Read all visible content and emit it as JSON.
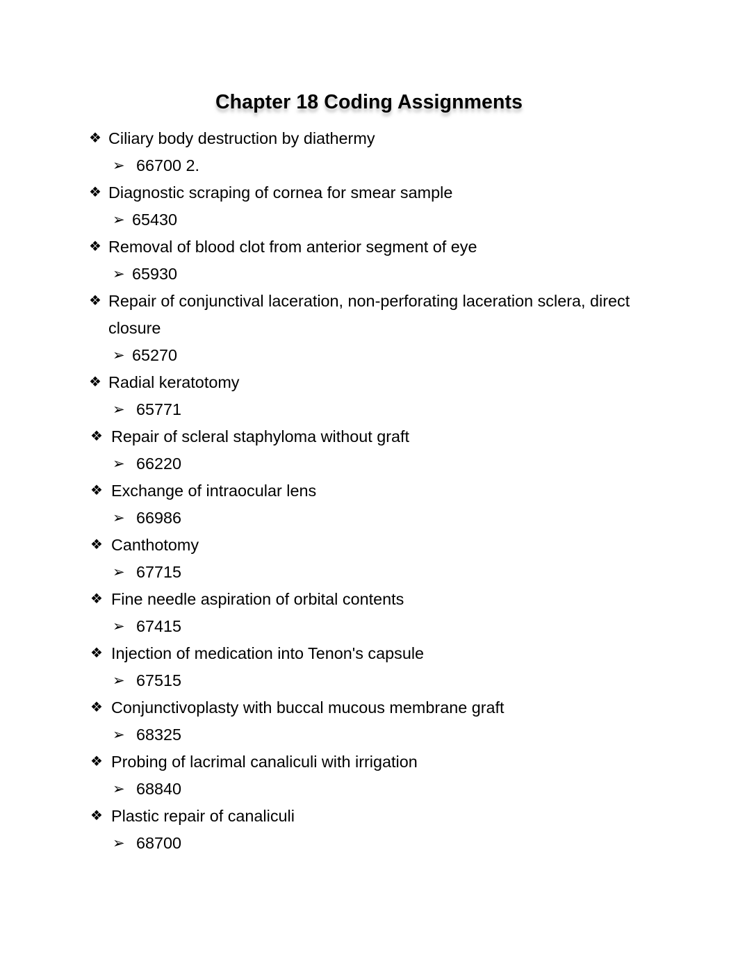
{
  "document": {
    "title": "Chapter 18 Coding Assignments",
    "background_color": "#ffffff",
    "text_color": "#000000",
    "title_shadow_color": "#8c8c8c"
  },
  "bullets": {
    "level1_glyph": "❖",
    "level1_glyph_name": "four-diamond-bullet-icon",
    "level2_glyph": "➢",
    "level2_glyph_name": "arrowhead-bullet-icon"
  },
  "items": [
    {
      "procedure": "Ciliary body destruction by diathermy",
      "code": "66700 2.",
      "indent_group": 1,
      "code_wide": true
    },
    {
      "procedure": "Diagnostic scraping of cornea for smear sample",
      "code": "65430",
      "indent_group": 1,
      "code_wide": false
    },
    {
      "procedure": "Removal of blood clot from anterior segment of eye",
      "code": "65930",
      "indent_group": 1,
      "code_wide": false
    },
    {
      "procedure": "Repair of conjunctival laceration, non-perforating laceration sclera, direct closure",
      "code": "65270",
      "indent_group": 1,
      "code_wide": false
    },
    {
      "procedure": "Radial keratotomy",
      "code": "65771",
      "indent_group": 1,
      "code_wide": true
    },
    {
      "procedure": "Repair of scleral staphyloma without graft",
      "code": "66220",
      "indent_group": 2,
      "code_wide": true
    },
    {
      "procedure": "Exchange of intraocular lens",
      "code": "66986",
      "indent_group": 2,
      "code_wide": true
    },
    {
      "procedure": "Canthotomy",
      "code": "67715",
      "indent_group": 2,
      "code_wide": true
    },
    {
      "procedure": "Fine needle aspiration of orbital contents",
      "code": "67415",
      "indent_group": 2,
      "code_wide": true
    },
    {
      "procedure": "Injection of medication into Tenon's capsule",
      "code": "67515",
      "indent_group": 2,
      "code_wide": true
    },
    {
      "procedure": "Conjunctivoplasty with buccal mucous membrane graft",
      "code": "68325",
      "indent_group": 2,
      "code_wide": true
    },
    {
      "procedure": "Probing of lacrimal canaliculi with irrigation",
      "code": "68840",
      "indent_group": 2,
      "code_wide": true
    },
    {
      "procedure": "Plastic repair of canaliculi",
      "code": "68700",
      "indent_group": 2,
      "code_wide": true
    }
  ]
}
